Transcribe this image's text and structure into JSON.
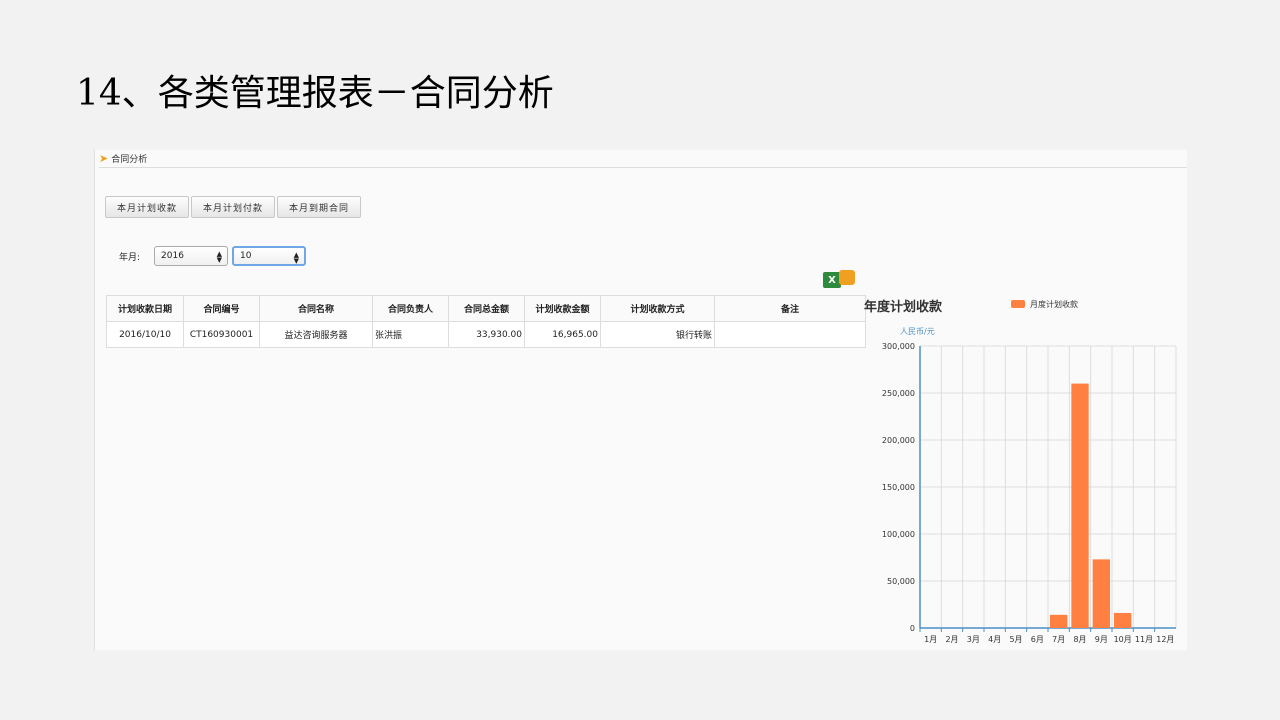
{
  "slide": {
    "title": "14、各类管理报表－合同分析"
  },
  "breadcrumb": {
    "label": "合同分析"
  },
  "toolbar": {
    "buttons": [
      "本月计划收款",
      "本月计划付款",
      "本月到期合同"
    ]
  },
  "filter": {
    "label": "年月:",
    "year": "2016",
    "month": "10"
  },
  "table": {
    "headers": [
      "计划收款日期",
      "合同编号",
      "合同名称",
      "合同负责人",
      "合同总金额",
      "计划收款金额",
      "计划收款方式",
      "备注"
    ],
    "rows": [
      [
        "2016/10/10",
        "CT160930001",
        "益达咨询服务器",
        "张洪振",
        "33,930.00",
        "16,965.00",
        "银行转账",
        ""
      ]
    ]
  },
  "colors": {
    "bar": "#ff8040",
    "axis": "#4a90c8",
    "accent": "#f0a020"
  },
  "chart_data": {
    "type": "bar",
    "title": "年度计划收款",
    "ylabel": "人民币/元",
    "categories": [
      "1月",
      "2月",
      "3月",
      "4月",
      "5月",
      "6月",
      "7月",
      "8月",
      "9月",
      "10月",
      "11月",
      "12月"
    ],
    "series": [
      {
        "name": "月度计划收款",
        "values": [
          0,
          0,
          0,
          0,
          0,
          0,
          14000,
          260000,
          73000,
          16000,
          0,
          0
        ]
      }
    ],
    "ylim": [
      0,
      300000
    ],
    "yticks": [
      0,
      50000,
      100000,
      150000,
      200000,
      250000,
      300000
    ],
    "ytick_labels": [
      "0",
      "50,000",
      "100,000",
      "150,000",
      "200,000",
      "250,000",
      "300,000"
    ],
    "legend": "top-right",
    "grid": true
  }
}
